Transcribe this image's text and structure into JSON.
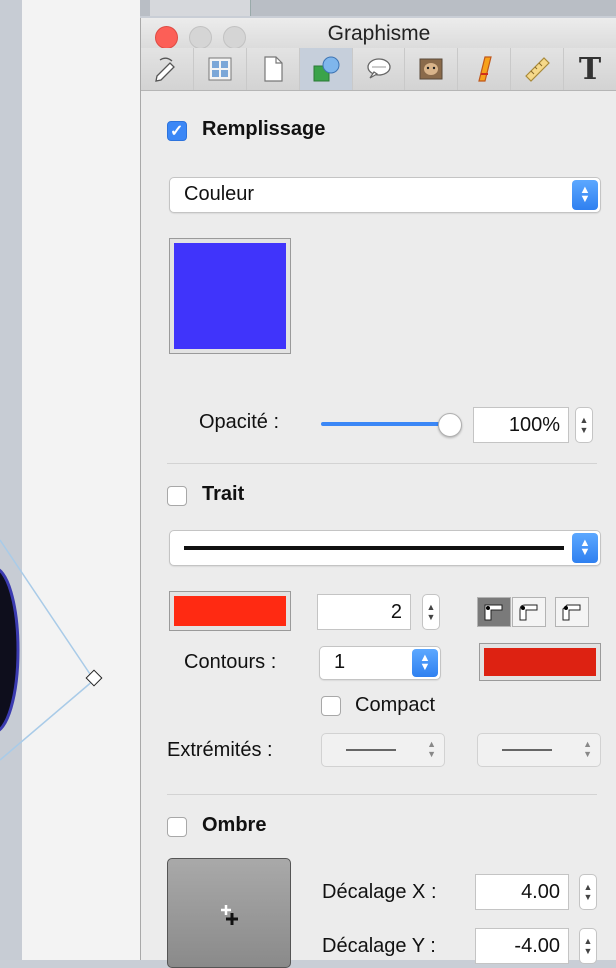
{
  "window": {
    "title": "Graphisme"
  },
  "toolbar": {
    "tabs": [
      {
        "icon": "pencil-icon"
      },
      {
        "icon": "grid-icon"
      },
      {
        "icon": "document-icon"
      },
      {
        "icon": "shapes-icon",
        "active": true
      },
      {
        "icon": "speech-bubble-icon"
      },
      {
        "icon": "image-icon"
      },
      {
        "icon": "text-effect-icon"
      },
      {
        "icon": "ruler-icon"
      },
      {
        "icon": "typography-icon",
        "label": "T"
      }
    ]
  },
  "fill": {
    "checkbox_label": "Remplissage",
    "checked": true,
    "type_value": "Couleur",
    "color": "#4034fb",
    "opacity_label": "Opacité :",
    "opacity_value": "100%",
    "opacity_fraction": 1.0
  },
  "stroke": {
    "checkbox_label": "Trait",
    "checked": false,
    "color": "#ff2a12",
    "width_value": "2",
    "outlines_label": "Contours :",
    "outlines_value": "1",
    "outline_color": "#dd2212",
    "compact_label": "Compact",
    "compact_checked": false,
    "ends_label": "Extrémités :"
  },
  "shadow": {
    "checkbox_label": "Ombre",
    "checked": false,
    "offset_x_label": "Décalage X :",
    "offset_x_value": "4.00",
    "offset_y_label": "Décalage Y :",
    "offset_y_value": "-4.00"
  }
}
